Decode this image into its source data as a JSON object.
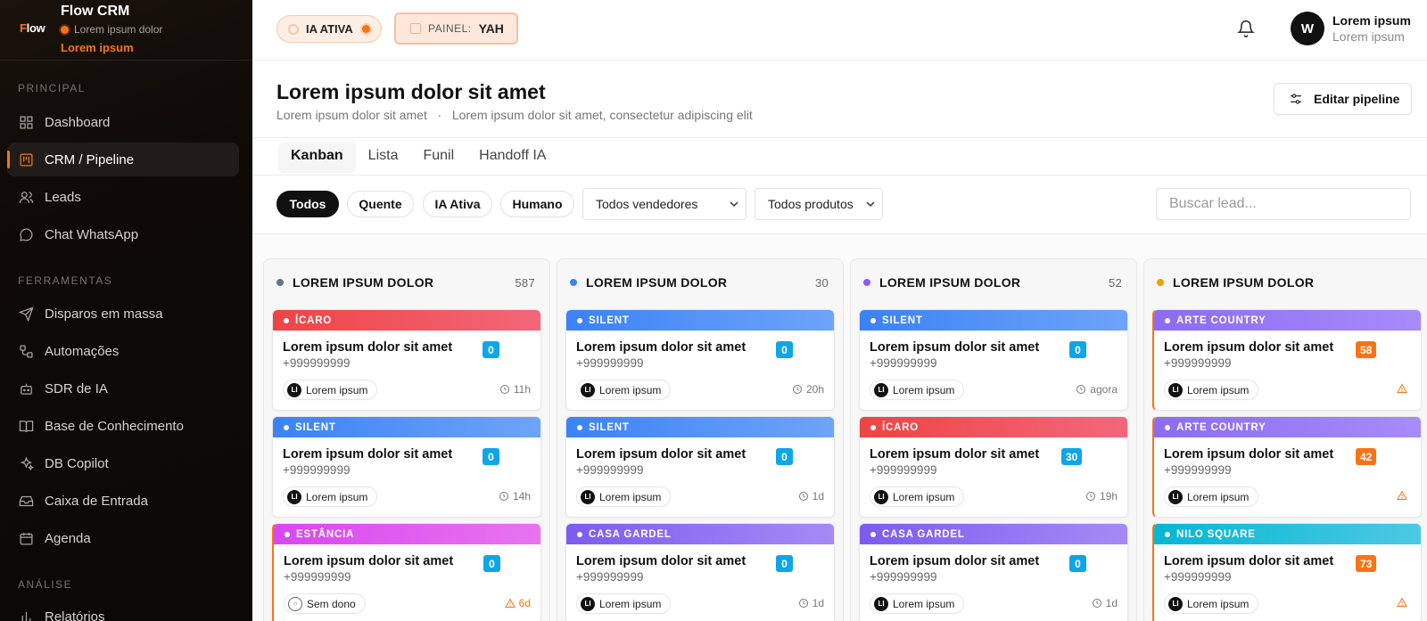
{
  "brand": {
    "logo_prefix": "F",
    "logo_rest": "low",
    "title": "Flow CRM",
    "subtitle": "Lorem ipsum dolor",
    "link": "Lorem ipsum"
  },
  "sidebar": {
    "sections": [
      "PRINCIPAL",
      "FERRAMENTAS",
      "ANÁLISE"
    ],
    "items": [
      {
        "label": "Dashboard",
        "icon": "grid-icon"
      },
      {
        "label": "CRM / Pipeline",
        "icon": "kanban-icon"
      },
      {
        "label": "Leads",
        "icon": "users-icon"
      },
      {
        "label": "Chat WhatsApp",
        "icon": "chat-icon"
      },
      {
        "label": "Disparos em massa",
        "icon": "send-icon"
      },
      {
        "label": "Automações",
        "icon": "workflow-icon"
      },
      {
        "label": "SDR de IA",
        "icon": "bot-icon"
      },
      {
        "label": "Base de Conhecimento",
        "icon": "book-icon"
      },
      {
        "label": "DB Copilot",
        "icon": "sparkles-icon"
      },
      {
        "label": "Caixa de Entrada",
        "icon": "inbox-icon"
      },
      {
        "label": "Agenda",
        "icon": "calendar-icon"
      },
      {
        "label": "Relatórios",
        "icon": "bar-chart-icon"
      }
    ]
  },
  "header": {
    "ia_label": "IA ATIVA",
    "painel_label": "PAINEL:",
    "painel_value": "YAH",
    "avatar_initial": "W",
    "user_name": "Lorem ipsum",
    "user_role": "Lorem ipsum"
  },
  "page": {
    "title": "Lorem ipsum dolor sit amet",
    "subtitle": "Lorem ipsum dolor sit amet   ·   Lorem ipsum dolor sit amet, consectetur adipiscing elit",
    "edit_button": "Editar pipeline"
  },
  "tabs": [
    "Kanban",
    "Lista",
    "Funil",
    "Handoff IA"
  ],
  "filters": {
    "chips": [
      "Todos",
      "Quente",
      "IA Ativa",
      "Humano"
    ],
    "sellers": "Todos vendedores",
    "products": "Todos produtos",
    "search_placeholder": "Buscar lead..."
  },
  "colors": {
    "accent": "#f97316",
    "sidebar_bg": "#0d0a08"
  },
  "columns": [
    {
      "title": "LOREM IPSUM DOLOR",
      "count": "587",
      "dot": "#64748b",
      "cards": [
        {
          "tag": "ÍCARO",
          "tag_color": "red",
          "name": "Lorem ipsum dolor sit amet",
          "phone": "+999999999",
          "badge": "0",
          "badge_color": "#0ea5e9",
          "owner_initials": "LI",
          "owner": "Lorem ipsum",
          "time": "11h",
          "warn": false
        },
        {
          "tag": "SILENT",
          "tag_color": "blue",
          "name": "Lorem ipsum dolor sit amet",
          "phone": "+999999999",
          "badge": "0",
          "badge_color": "#0ea5e9",
          "owner_initials": "LI",
          "owner": "Lorem ipsum",
          "time": "14h",
          "warn": false
        },
        {
          "tag": "ESTÂNCIA",
          "tag_color": "magenta",
          "name": "Lorem ipsum dolor sit amet",
          "phone": "+999999999",
          "badge": "0",
          "badge_color": "#0ea5e9",
          "owner_initials": "",
          "owner": "Sem dono",
          "time": "6d",
          "warn": true
        }
      ]
    },
    {
      "title": "LOREM IPSUM DOLOR",
      "count": "30",
      "dot": "#3b82f6",
      "cards": [
        {
          "tag": "SILENT",
          "tag_color": "blue",
          "name": "Lorem ipsum dolor sit amet",
          "phone": "+999999999",
          "badge": "0",
          "badge_color": "#0ea5e9",
          "owner_initials": "LI",
          "owner": "Lorem ipsum",
          "time": "20h",
          "warn": false
        },
        {
          "tag": "SILENT",
          "tag_color": "blue",
          "name": "Lorem ipsum dolor sit amet",
          "phone": "+999999999",
          "badge": "0",
          "badge_color": "#0ea5e9",
          "owner_initials": "LI",
          "owner": "Lorem ipsum",
          "time": "1d",
          "warn": false
        },
        {
          "tag": "CASA GARDEL",
          "tag_color": "purple",
          "name": "Lorem ipsum dolor sit amet",
          "phone": "+999999999",
          "badge": "0",
          "badge_color": "#0ea5e9",
          "owner_initials": "LI",
          "owner": "Lorem ipsum",
          "time": "1d",
          "warn": false
        }
      ]
    },
    {
      "title": "LOREM IPSUM DOLOR",
      "count": "52",
      "dot": "#8b5cf6",
      "cards": [
        {
          "tag": "SILENT",
          "tag_color": "blue",
          "name": "Lorem ipsum dolor sit amet",
          "phone": "+999999999",
          "badge": "0",
          "badge_color": "#0ea5e9",
          "owner_initials": "LI",
          "owner": "Lorem ipsum",
          "time": "agora",
          "warn": false
        },
        {
          "tag": "ÍCARO",
          "tag_color": "red",
          "name": "Lorem ipsum dolor sit amet",
          "phone": "+999999999",
          "badge": "30",
          "badge_color": "#0ea5e9",
          "owner_initials": "LI",
          "owner": "Lorem ipsum",
          "time": "19h",
          "warn": false
        },
        {
          "tag": "CASA GARDEL",
          "tag_color": "purple",
          "name": "Lorem ipsum dolor sit amet",
          "phone": "+999999999",
          "badge": "0",
          "badge_color": "#0ea5e9",
          "owner_initials": "LI",
          "owner": "Lorem ipsum",
          "time": "1d",
          "warn": false
        }
      ]
    },
    {
      "title": "LOREM IPSUM DOLOR",
      "count": "",
      "dot": "#f59e0b",
      "cards": [
        {
          "tag": "ARTE COUNTRY",
          "tag_color": "violet",
          "name": "Lorem ipsum dolor sit amet",
          "phone": "+999999999",
          "badge": "58",
          "badge_color": "#f97316",
          "owner_initials": "LI",
          "owner": "Lorem ipsum",
          "time": "",
          "warn": true
        },
        {
          "tag": "ARTE COUNTRY",
          "tag_color": "violet",
          "name": "Lorem ipsum dolor sit amet",
          "phone": "+999999999",
          "badge": "42",
          "badge_color": "#f97316",
          "owner_initials": "LI",
          "owner": "Lorem ipsum",
          "time": "",
          "warn": true
        },
        {
          "tag": "NILO SQUARE",
          "tag_color": "cyan",
          "name": "Lorem ipsum dolor sit amet",
          "phone": "+999999999",
          "badge": "73",
          "badge_color": "#f97316",
          "owner_initials": "LI",
          "owner": "Lorem ipsum",
          "time": "",
          "warn": true
        }
      ]
    }
  ]
}
